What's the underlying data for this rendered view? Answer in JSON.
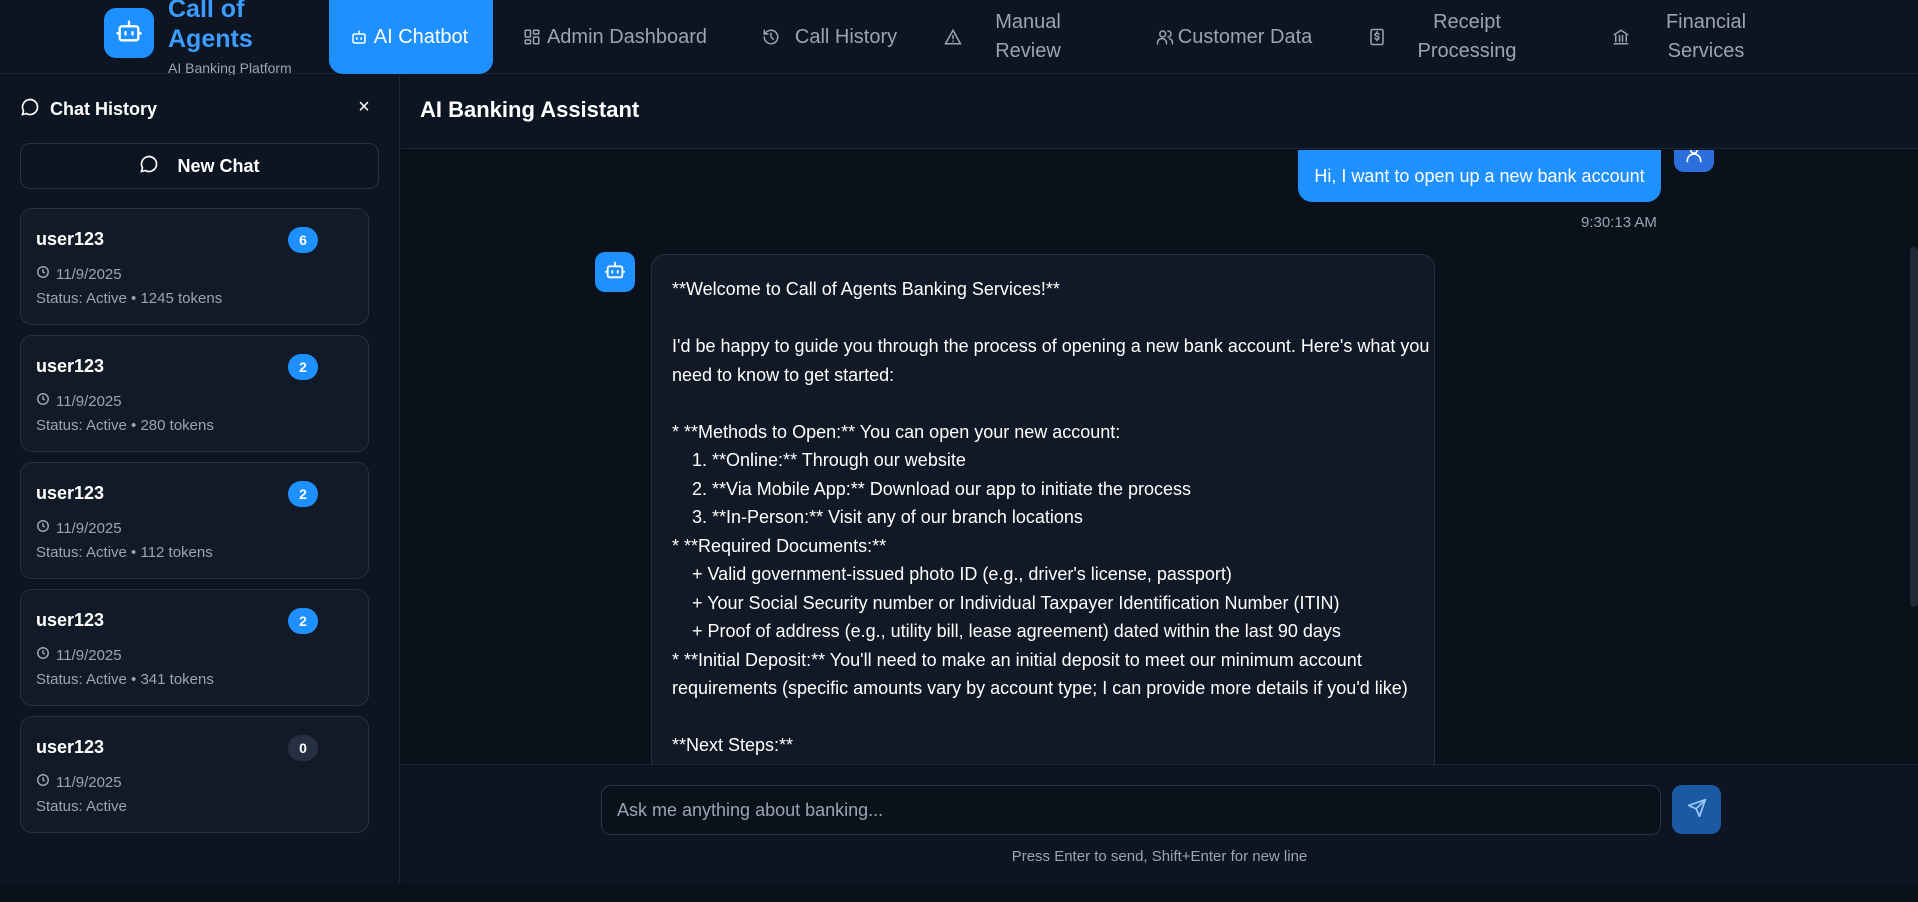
{
  "brand": {
    "title": "Call of Agents",
    "subtitle": "AI Banking Platform",
    "icon": "robot-icon",
    "accent_color": "#1e90ff"
  },
  "nav": {
    "tabs": [
      {
        "label": "AI Chatbot",
        "icon": "robot-icon",
        "active": true
      },
      {
        "label": "Admin Dashboard",
        "icon": "dashboard-grid-icon",
        "active": false
      },
      {
        "label": "Call History",
        "icon": "history-icon",
        "active": false
      },
      {
        "label": "Manual Review",
        "icon": "warning-triangle-icon",
        "active": false
      },
      {
        "label": "Customer Data",
        "icon": "users-icon",
        "active": false
      },
      {
        "label": "Receipt Processing",
        "icon": "receipt-dollar-icon",
        "active": false
      },
      {
        "label": "Financial Services",
        "icon": "bank-icon",
        "active": false
      }
    ]
  },
  "sidebar": {
    "title": "Chat History",
    "close_label": "×",
    "new_chat_label": "New Chat",
    "chats": [
      {
        "user": "user123",
        "count": "6",
        "date": "11/9/2025",
        "status": "Status: Active  • 1245 tokens"
      },
      {
        "user": "user123",
        "count": "2",
        "date": "11/9/2025",
        "status": "Status: Active  • 280 tokens"
      },
      {
        "user": "user123",
        "count": "2",
        "date": "11/9/2025",
        "status": "Status: Active  • 112 tokens"
      },
      {
        "user": "user123",
        "count": "2",
        "date": "11/9/2025",
        "status": "Status: Active  • 341 tokens"
      },
      {
        "user": "user123",
        "count": "0",
        "date": "11/9/2025",
        "status": "Status: Active"
      }
    ]
  },
  "main": {
    "title": "AI Banking Assistant",
    "user_message": "Hi, I want to open up a new bank account",
    "user_message_time": "9:30:13 AM",
    "bot_message_lines": [
      "**Welcome to Call of Agents Banking Services!**",
      "",
      "I'd be happy to guide you through the process of opening a new bank account. Here's what you",
      "need to know to get started:",
      "",
      "* **Methods to Open:** You can open your new account:",
      "    1. **Online:** Through our website",
      "    2. **Via Mobile App:** Download our app to initiate the process",
      "    3. **In-Person:** Visit any of our branch locations",
      "* **Required Documents:**",
      "    + Valid government-issued photo ID (e.g., driver's license, passport)",
      "    + Your Social Security number or Individual Taxpayer Identification Number (ITIN)",
      "    + Proof of address (e.g., utility bill, lease agreement) dated within the last 90 days",
      "* **Initial Deposit:** You'll need to make an initial deposit to meet our minimum account",
      "requirements (specific amounts vary by account type; I can provide more details if you'd like)",
      "",
      "**Next Steps:**"
    ]
  },
  "composer": {
    "placeholder": "Ask me anything about banking...",
    "value": "",
    "hint": "Press Enter to send, Shift+Enter for new line",
    "send_icon": "send-icon"
  }
}
